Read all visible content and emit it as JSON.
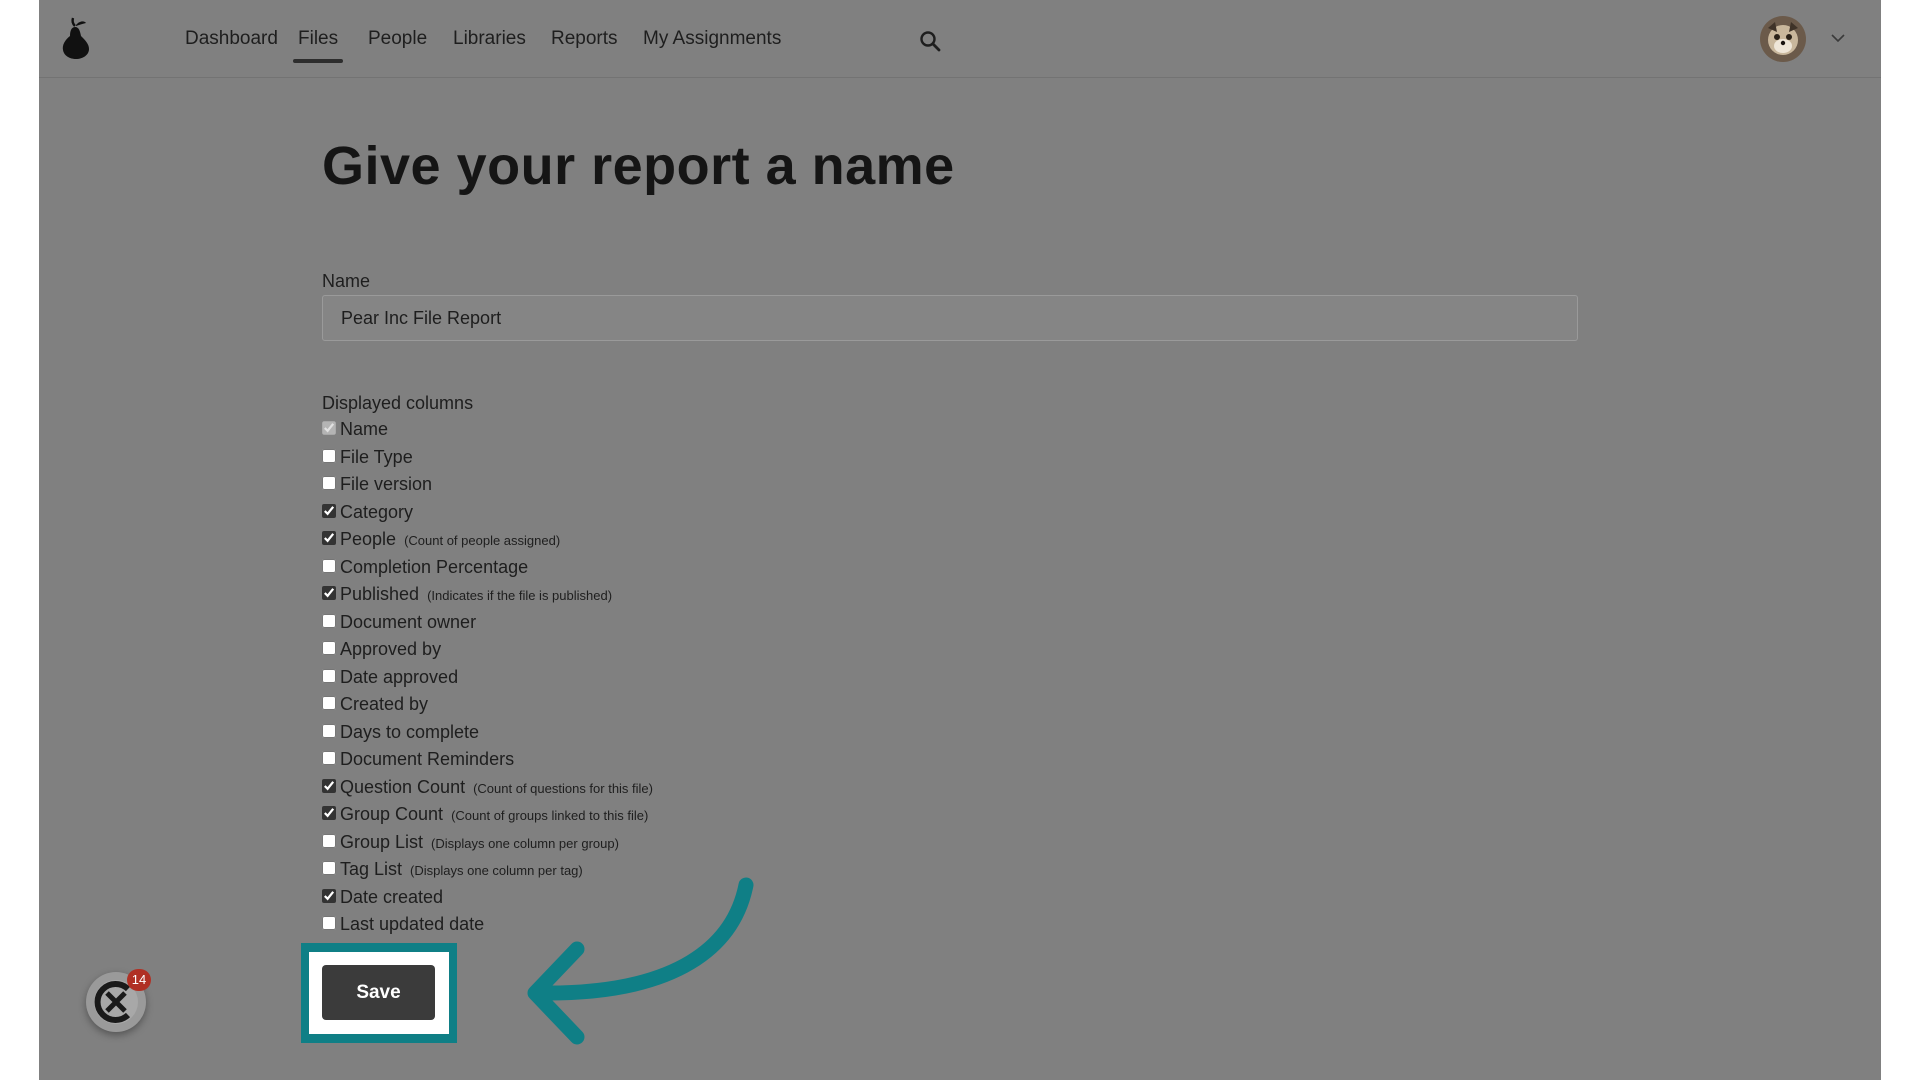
{
  "nav": {
    "items": [
      {
        "label": "Dashboard",
        "active": false
      },
      {
        "label": "Files",
        "active": true
      },
      {
        "label": "People",
        "active": false
      },
      {
        "label": "Libraries",
        "active": false
      },
      {
        "label": "Reports",
        "active": false
      },
      {
        "label": "My Assignments",
        "active": false
      }
    ],
    "search_icon": "search-icon",
    "logo_icon": "pear-logo-icon",
    "account_caret_icon": "chevron-down-icon"
  },
  "page": {
    "title": "Give your report a name",
    "name_label": "Name",
    "name_value": "Pear Inc File Report",
    "columns_label": "Displayed columns",
    "columns": [
      {
        "label": "Name",
        "hint": "",
        "checked": true,
        "disabled": true
      },
      {
        "label": "File Type",
        "hint": "",
        "checked": false,
        "disabled": false
      },
      {
        "label": "File version",
        "hint": "",
        "checked": false,
        "disabled": false
      },
      {
        "label": "Category",
        "hint": "",
        "checked": true,
        "disabled": false
      },
      {
        "label": "People",
        "hint": "(Count of people assigned)",
        "checked": true,
        "disabled": false
      },
      {
        "label": "Completion Percentage",
        "hint": "",
        "checked": false,
        "disabled": false
      },
      {
        "label": "Published",
        "hint": "(Indicates if the file is published)",
        "checked": true,
        "disabled": false
      },
      {
        "label": "Document owner",
        "hint": "",
        "checked": false,
        "disabled": false
      },
      {
        "label": "Approved by",
        "hint": "",
        "checked": false,
        "disabled": false
      },
      {
        "label": "Date approved",
        "hint": "",
        "checked": false,
        "disabled": false
      },
      {
        "label": "Created by",
        "hint": "",
        "checked": false,
        "disabled": false
      },
      {
        "label": "Days to complete",
        "hint": "",
        "checked": false,
        "disabled": false
      },
      {
        "label": "Document Reminders",
        "hint": "",
        "checked": false,
        "disabled": false
      },
      {
        "label": "Question Count",
        "hint": "(Count of questions for this file)",
        "checked": true,
        "disabled": false
      },
      {
        "label": "Group Count",
        "hint": "(Count of groups linked to this file)",
        "checked": true,
        "disabled": false
      },
      {
        "label": "Group List",
        "hint": "(Displays one column per group)",
        "checked": false,
        "disabled": false
      },
      {
        "label": "Tag List",
        "hint": "(Displays one column per tag)",
        "checked": false,
        "disabled": false
      },
      {
        "label": "Date created",
        "hint": "",
        "checked": true,
        "disabled": false
      },
      {
        "label": "Last updated date",
        "hint": "",
        "checked": false,
        "disabled": false
      }
    ],
    "save_label": "Save"
  },
  "help_widget": {
    "badge": "14",
    "icon": "help-widget-icon"
  },
  "colors": {
    "overlay": "#808080",
    "highlight": "#0f7f86",
    "save_button": "#3b3b3b",
    "badge": "#b03024"
  }
}
